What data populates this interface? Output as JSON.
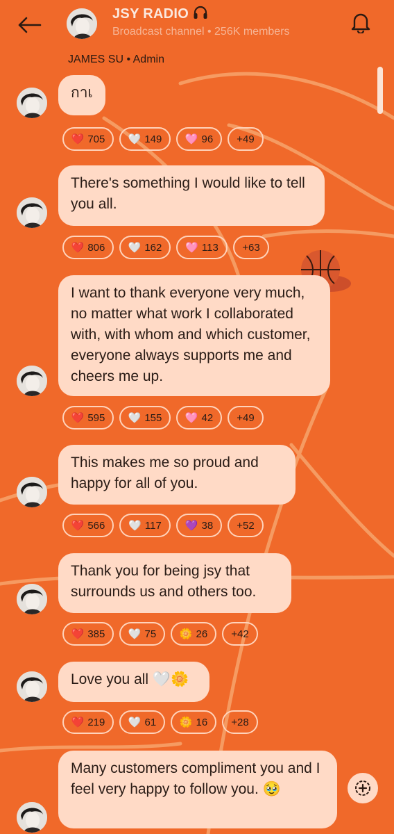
{
  "header": {
    "title": "JSY RADIO",
    "subtitle": "Broadcast channel • 256K members",
    "title_icon": "headphones-icon"
  },
  "sender": "JAMES SU • Admin",
  "messages": [
    {
      "text": "กาเ",
      "reactions": [
        "705",
        "149",
        "96",
        "+49"
      ],
      "emojis": [
        "red-heart",
        "white-heart",
        "pink-heart"
      ]
    },
    {
      "text": "There's something I would like to tell you all.",
      "reactions": [
        "806",
        "162",
        "113",
        "+63"
      ],
      "emojis": [
        "red-heart",
        "white-heart",
        "pink-heart"
      ]
    },
    {
      "text": "I want to thank everyone very much, no matter what work I collaborated with, with whom and which customer, everyone always supports me and cheers me up.",
      "reactions": [
        "595",
        "155",
        "42",
        "+49"
      ],
      "emojis": [
        "red-heart",
        "white-heart",
        "pink-heart"
      ]
    },
    {
      "text": "This makes me so proud and happy for all of you.",
      "reactions": [
        "566",
        "117",
        "38",
        "+52"
      ],
      "emojis": [
        "red-heart",
        "white-heart",
        "purple-heart"
      ]
    },
    {
      "text": "Thank you for being jsy that surrounds us and others too.",
      "reactions": [
        "385",
        "75",
        "26",
        "+42"
      ],
      "emojis": [
        "red-heart",
        "white-heart",
        "blossom"
      ]
    },
    {
      "text": "Love you all 🤍🌼",
      "reactions": [
        "219",
        "61",
        "16",
        "+28"
      ],
      "emojis": [
        "red-heart",
        "white-heart",
        "blossom"
      ]
    },
    {
      "text": "Many customers compliment you and I feel very happy to follow you. 🥹",
      "reactions": [],
      "emojis": []
    }
  ],
  "colors": {
    "background": "#f0692a",
    "bubble": "#ffdac6",
    "chip_border": "#ffd3bb",
    "red_heart": "#e8252f",
    "pink_heart": "#f06fc6",
    "purple_heart": "#8a3fd6"
  }
}
